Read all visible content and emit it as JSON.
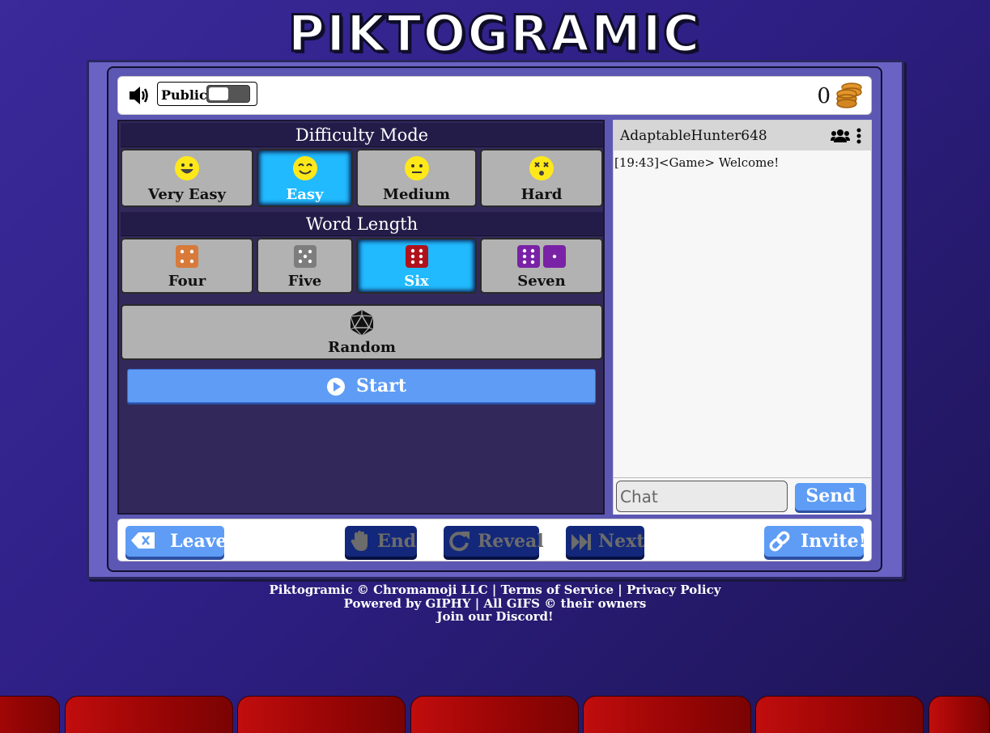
{
  "logo": "PIKTOGRAMIC",
  "top_bar": {
    "public_label": "Public",
    "public_toggle_on": false,
    "coin_count": "0"
  },
  "difficulty": {
    "header": "Difficulty Mode",
    "options": [
      {
        "label": "Very Easy",
        "selected": false
      },
      {
        "label": "Easy",
        "selected": true
      },
      {
        "label": "Medium",
        "selected": false
      },
      {
        "label": "Hard",
        "selected": false
      }
    ]
  },
  "word_length": {
    "header": "Word Length",
    "options": [
      {
        "label": "Four",
        "selected": false
      },
      {
        "label": "Five",
        "selected": false
      },
      {
        "label": "Six",
        "selected": true
      },
      {
        "label": "Seven",
        "selected": false
      }
    ],
    "random_label": "Random"
  },
  "start_label": "Start",
  "chat": {
    "username": "AdaptableHunter648",
    "messages": [
      "[19:43]<Game> Welcome!"
    ],
    "input_placeholder": "Chat",
    "send_label": "Send"
  },
  "bottom_bar": {
    "leave_label": "Leave",
    "end_label": "End",
    "reveal_label": "Reveal",
    "next_label": "Next",
    "invite_label": "Invite!"
  },
  "footer": {
    "line1": "Piktogramic © Chromamoji LLC | Terms of Service | Privacy Policy",
    "line2": "Powered by GIPHY | All GIFS © their owners",
    "line3": "Join our Discord!"
  },
  "colors": {
    "accent_blue": "#5e9cf5",
    "selected_cyan": "#21baff",
    "dark_button": "#13287a",
    "panel_dark": "#32295a"
  }
}
